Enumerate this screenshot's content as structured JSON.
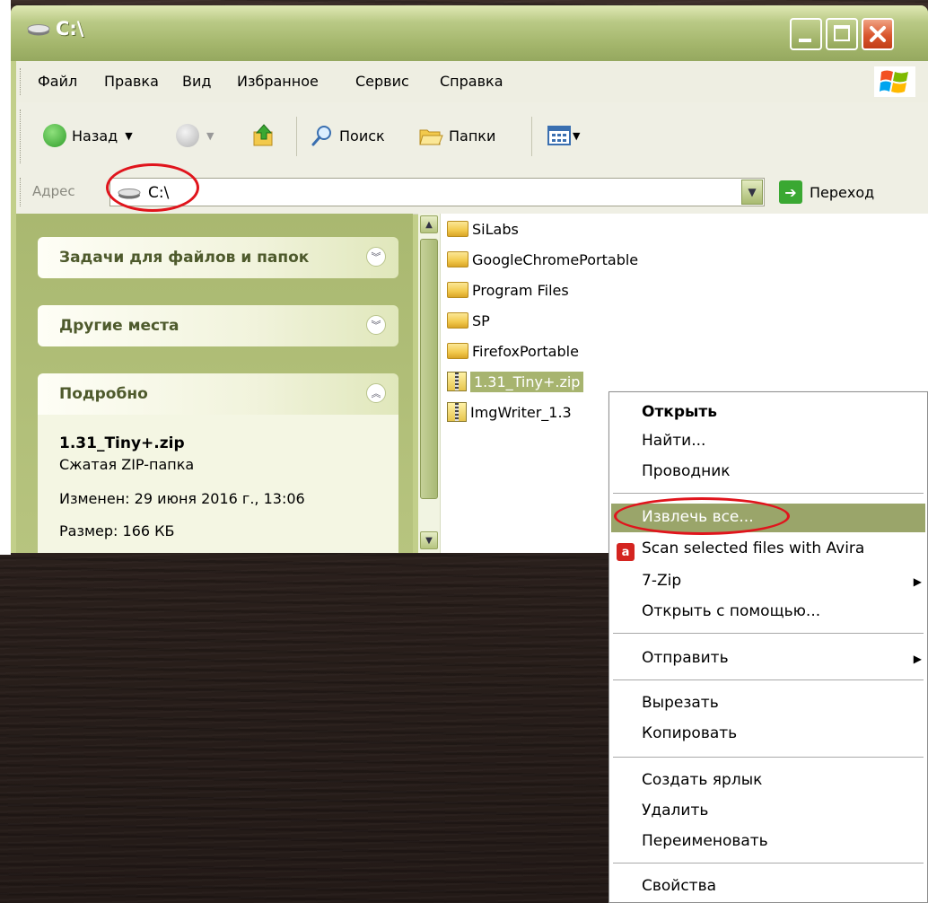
{
  "window": {
    "title": "C:\\",
    "colors": {
      "titlebar": "#a4b66c",
      "close": "#d9562e",
      "selection": "#a7b46f"
    }
  },
  "menubar": {
    "items": [
      "Файл",
      "Правка",
      "Вид",
      "Избранное",
      "Сервис",
      "Справка"
    ]
  },
  "toolbar": {
    "back_label": "Назад",
    "search_label": "Поиск",
    "folders_label": "Папки"
  },
  "address": {
    "label": "Адрес",
    "value": "C:\\",
    "go_label": "Переход"
  },
  "taskpane": {
    "file_tasks": "Задачи для файлов и папок",
    "other_places": "Другие места",
    "details": {
      "title": "Подробно",
      "name": "1.31_Tiny+.zip",
      "type": "Сжатая ZIP-папка",
      "modified": "Изменен: 29 июня 2016 г., 13:06",
      "size": "Размер: 166 КБ"
    }
  },
  "files": [
    {
      "name": "SiLabs",
      "kind": "folder"
    },
    {
      "name": "GoogleChromePortable",
      "kind": "folder"
    },
    {
      "name": "Program Files",
      "kind": "folder"
    },
    {
      "name": "SP",
      "kind": "folder"
    },
    {
      "name": "FirefoxPortable",
      "kind": "folder"
    },
    {
      "name": "1.31_Tiny+.zip",
      "kind": "zip",
      "selected": true
    },
    {
      "name": "ImgWriter_1.3",
      "kind": "zip"
    }
  ],
  "context_menu": {
    "open": "Открыть",
    "find": "Найти...",
    "explorer": "Проводник",
    "extract_all": "Извлечь все...",
    "avira": "Scan selected files with Avira",
    "sevenzip": "7-Zip",
    "open_with": "Открыть с помощью...",
    "send_to": "Отправить",
    "cut": "Вырезать",
    "copy": "Копировать",
    "create_shortcut": "Создать ярлык",
    "delete": "Удалить",
    "rename": "Переименовать",
    "properties": "Свойства"
  }
}
